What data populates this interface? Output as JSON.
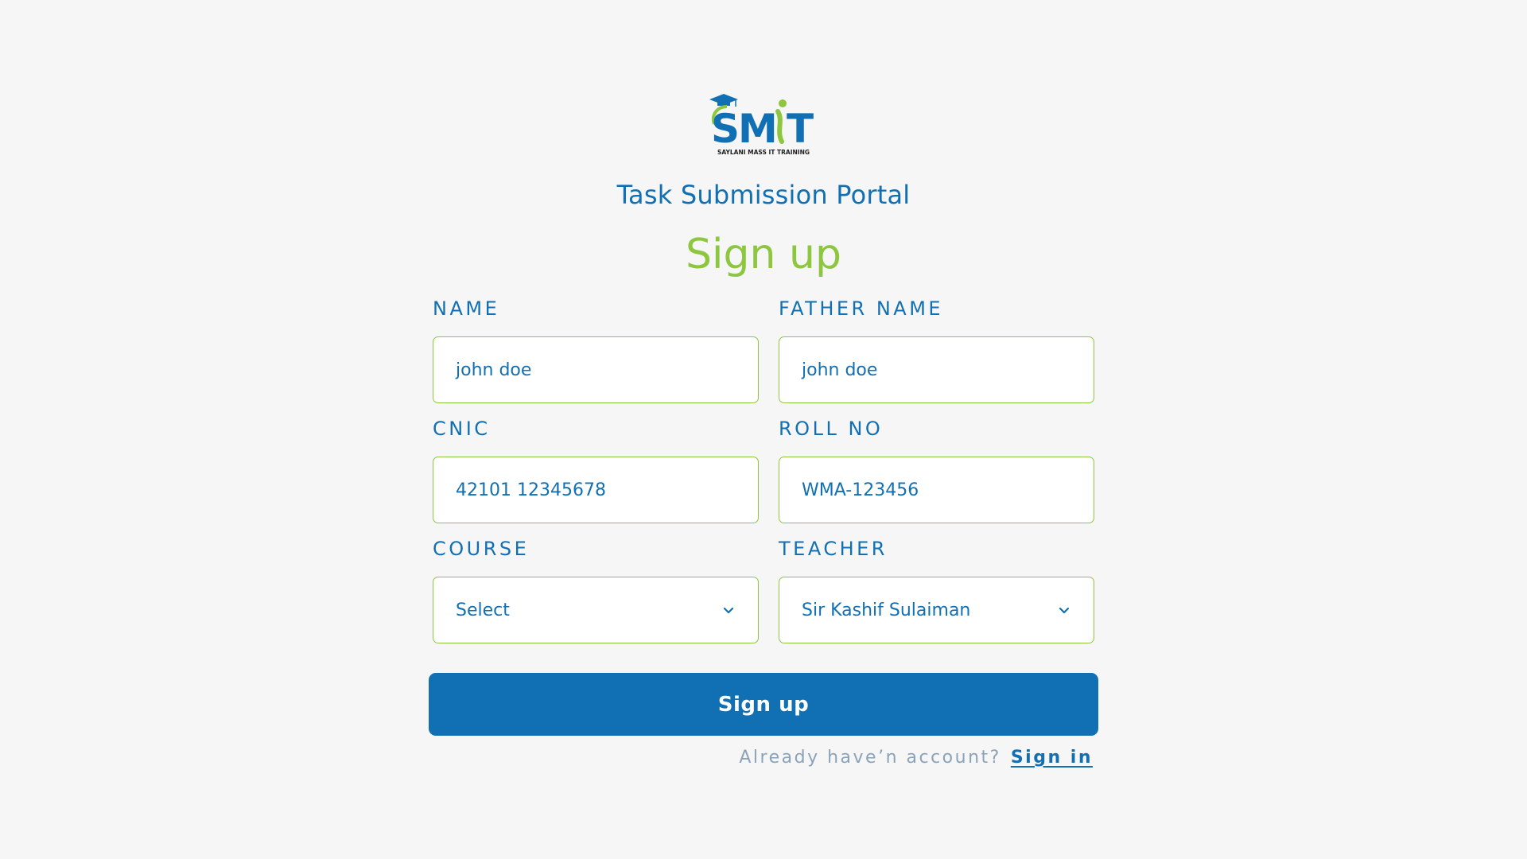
{
  "brand": {
    "logo_text": "SMiT",
    "logo_tagline": "SAYLANI MASS IT TRAINING",
    "primary_color": "#1170b4",
    "accent_color": "#8dc63f",
    "background_color": "#f6f6f6"
  },
  "header": {
    "portal_title": "Task Submission Portal",
    "page_title": "Sign up"
  },
  "form": {
    "name": {
      "label": "NAME",
      "value": "john doe"
    },
    "father_name": {
      "label": "FATHER NAME",
      "value": "john doe"
    },
    "cnic": {
      "label": "CNIC",
      "value": "42101 12345678"
    },
    "roll_no": {
      "label": "ROLL NO",
      "value": "WMA-123456"
    },
    "course": {
      "label": "COURSE",
      "selected": "Select",
      "icon": "chevron-down-icon"
    },
    "teacher": {
      "label": "TEACHER",
      "selected": "Sir Kashif Sulaiman",
      "icon": "chevron-down-icon"
    },
    "submit_label": "Sign up"
  },
  "footer": {
    "prompt": "Already have’n account?",
    "link_label": "Sign in"
  }
}
